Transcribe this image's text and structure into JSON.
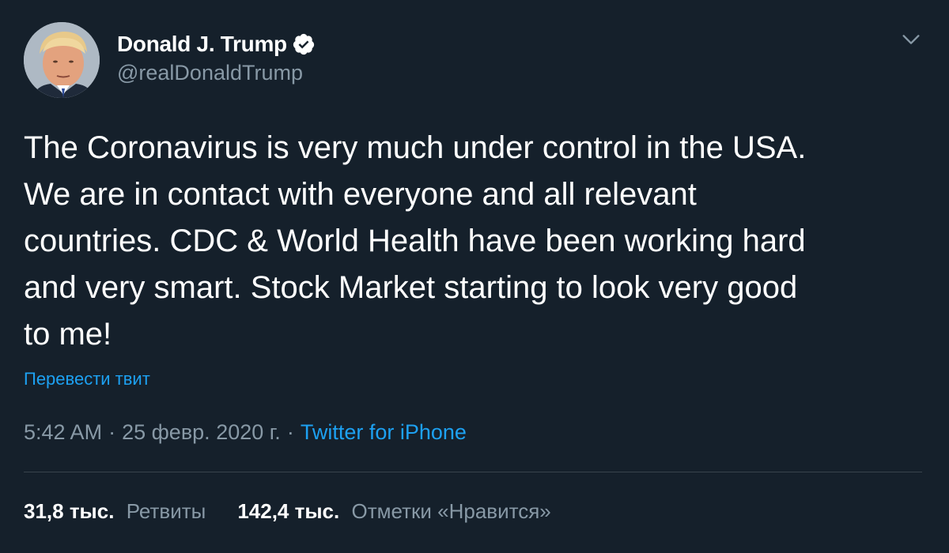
{
  "author": {
    "display_name": "Donald J. Trump",
    "handle": "@realDonaldTrump",
    "verified": true,
    "avatar_icon": "profile-photo"
  },
  "tweet": {
    "text": "The Coronavirus is very much under control in the USA.\nWe are in contact with everyone and all relevant\ncountries. CDC & World Health have been working hard\nand very smart. Stock Market starting to look very good\nto me!",
    "translate_label": "Перевести твит",
    "time": "5:42 AM",
    "date": "25 февр. 2020 г.",
    "separator": "·",
    "source": "Twitter for iPhone"
  },
  "stats": {
    "retweets_count": "31,8 тыс.",
    "retweets_label": "Ретвиты",
    "likes_count": "142,4 тыс.",
    "likes_label": "Отметки «Нравится»"
  },
  "colors": {
    "background": "#15202b",
    "accent": "#1da1f2",
    "secondary_text": "#8899a6",
    "divider": "#38444d"
  }
}
